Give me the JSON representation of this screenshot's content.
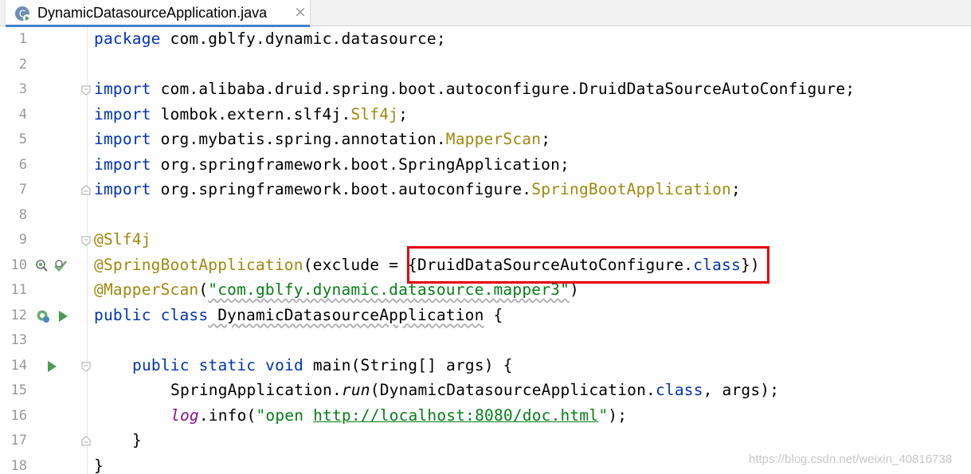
{
  "tab": {
    "title": "DynamicDatasourceApplication.java",
    "close_glyph": "×",
    "icon": "java-class-run-icon"
  },
  "editor": {
    "lines": [
      {
        "n": "1"
      },
      {
        "n": "2"
      },
      {
        "n": "3"
      },
      {
        "n": "4"
      },
      {
        "n": "5"
      },
      {
        "n": "6"
      },
      {
        "n": "7"
      },
      {
        "n": "8"
      },
      {
        "n": "9"
      },
      {
        "n": "10"
      },
      {
        "n": "11"
      },
      {
        "n": "12"
      },
      {
        "n": "13"
      },
      {
        "n": "14"
      },
      {
        "n": "15"
      },
      {
        "n": "16"
      },
      {
        "n": "17"
      },
      {
        "n": "18"
      }
    ],
    "code": {
      "l1_kw": "package",
      "l1_rest": " com.gblfy.dynamic.datasource;",
      "l3_kw": "import",
      "l3_rest": " com.alibaba.druid.spring.boot.autoconfigure.DruidDataSourceAutoConfigure;",
      "l4_kw": "import",
      "l4_rest": " lombok.extern.slf4j.",
      "l4_ann": "Slf4j",
      "l4_end": ";",
      "l5_kw": "import",
      "l5_rest": " org.mybatis.spring.annotation.",
      "l5_ann": "MapperScan",
      "l5_end": ";",
      "l6_kw": "import",
      "l6_rest": " org.springframework.boot.SpringApplication;",
      "l7_kw": "import",
      "l7_rest": " org.springframework.boot.autoconfigure.",
      "l7_ann": "SpringBootApplication",
      "l7_end": ";",
      "l9_ann": "@Slf4j",
      "l10_ann": "@SpringBootApplication",
      "l10_mid": "(exclude = ",
      "l10_boxed_a": "{DruidDataSourceAutoConfigure.",
      "l10_boxed_kw": "class",
      "l10_boxed_b": "})",
      "l11_ann": "@MapperScan",
      "l11_open": "(",
      "l11_str": "\"com.gblfy.dynamic.datasource.mapper3\"",
      "l11_close": ")",
      "l12_kw": "public class",
      "l12_name": " DynamicDatasourceApplication",
      "l12_end": " {",
      "l14_kw": "public static void",
      "l14_rest": " main(String[] args) {",
      "l15_a": "SpringApplication.",
      "l15_run": "run",
      "l15_b": "(DynamicDatasourceApplication.",
      "l15_kw": "class",
      "l15_c": ", args);",
      "l16_log": "log",
      "l16_a": ".info(",
      "l16_str_a": "\"open ",
      "l16_url": "http://localhost:8080/doc.html",
      "l16_str_b": "\"",
      "l16_c": ");",
      "l17": "}",
      "l18": "}"
    }
  },
  "watermark": "https://blog.csdn.net/weixin_40816738",
  "colors": {
    "keyword": "#0033b3",
    "annotation": "#9e880d",
    "string": "#067d17",
    "field": "#871094",
    "highlight_box": "#e60000",
    "tab_underline": "#4083c9"
  }
}
